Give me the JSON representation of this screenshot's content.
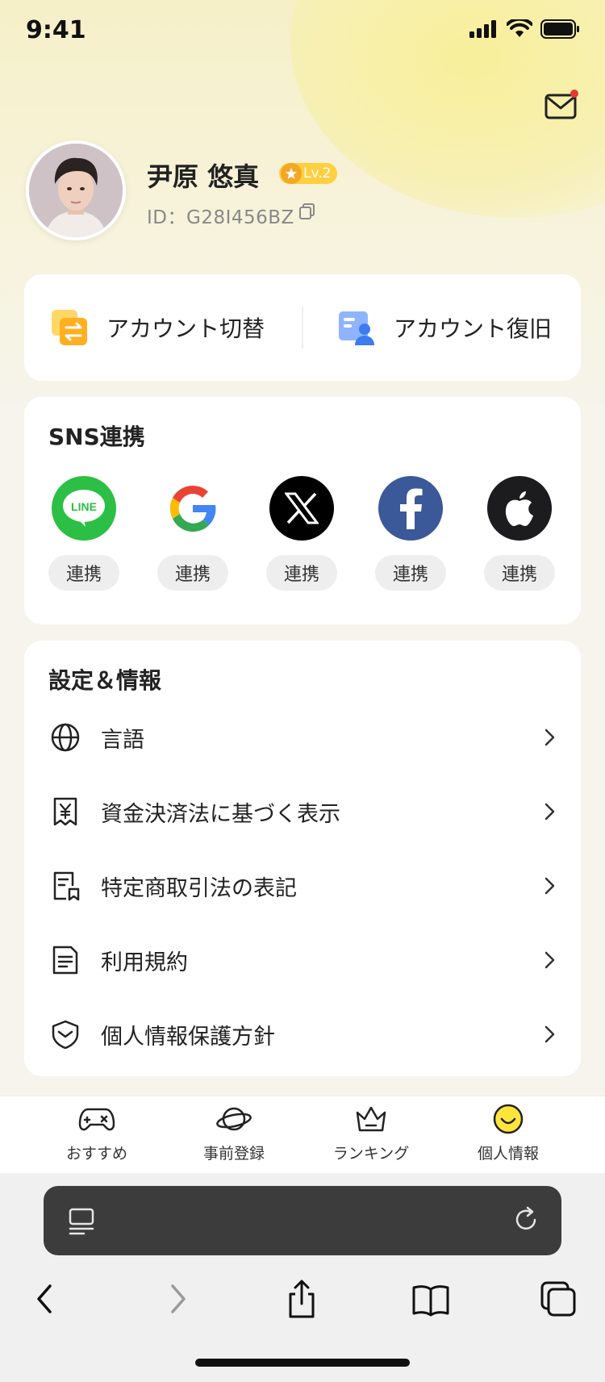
{
  "status_bar": {
    "time": "9:41"
  },
  "profile": {
    "name": "尹原 悠真",
    "level": "Lv.2",
    "id": "ID：G28I456BZ"
  },
  "account_actions": {
    "switch_label": "アカウント切替",
    "recover_label": "アカウント復旧"
  },
  "sns": {
    "title": "SNS連携",
    "items": [
      {
        "name": "LINE",
        "button": "連携",
        "color": "#2bbf46"
      },
      {
        "name": "Google",
        "button": "連携",
        "color": "#ffffff"
      },
      {
        "name": "X",
        "button": "連携",
        "color": "#000000"
      },
      {
        "name": "Facebook",
        "button": "連携",
        "color": "#3b5998"
      },
      {
        "name": "Apple",
        "button": "連携",
        "color": "#1c1c1e"
      }
    ],
    "line_logo_text": "LINE"
  },
  "settings": {
    "title": "設定＆情報",
    "items": [
      {
        "label": "言語",
        "icon": "globe-icon"
      },
      {
        "label": "資金決済法に基づく表示",
        "icon": "yen-receipt-icon"
      },
      {
        "label": "特定商取引法の表記",
        "icon": "document-bookmark-icon"
      },
      {
        "label": "利用規約",
        "icon": "document-lines-icon"
      },
      {
        "label": "個人情報保護方針",
        "icon": "shield-check-icon"
      }
    ]
  },
  "tab_bar": {
    "items": [
      {
        "label": "おすすめ",
        "icon": "gamepad-icon"
      },
      {
        "label": "事前登録",
        "icon": "planet-icon"
      },
      {
        "label": "ランキング",
        "icon": "crown-icon"
      },
      {
        "label": "個人情報",
        "icon": "smiley-icon",
        "active": true
      }
    ]
  },
  "colors": {
    "accent": "#ffcf3f",
    "badge_dot": "#e53935"
  }
}
